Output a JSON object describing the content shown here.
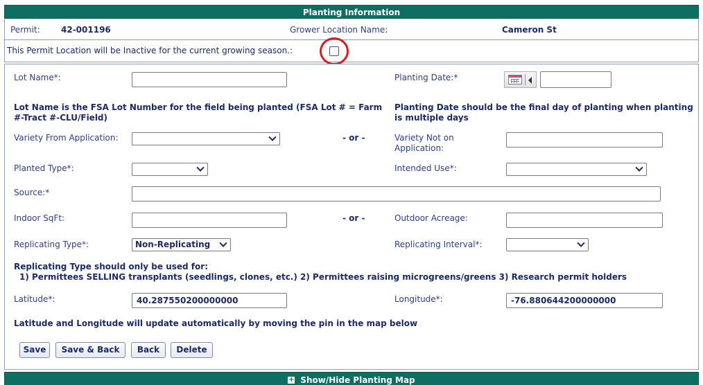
{
  "header": {
    "title": "Planting Information"
  },
  "permit": {
    "permit_label": "Permit:",
    "permit_value": "42-001196",
    "grower_location_label": "Grower Location Name:",
    "grower_location_value": "Cameron St"
  },
  "inactive": {
    "label": "This Permit Location will be Inactive for the current growing season.:",
    "checked": false
  },
  "form": {
    "lot_name_label": "Lot Name*:",
    "lot_name_value": "",
    "planting_date_label": "Planting Date:*",
    "planting_date_value": "",
    "lot_name_note": "Lot Name is the FSA Lot Number for the field being planted (FSA Lot # = Farm #-Tract #-CLU/Field)",
    "planting_date_note": "Planting Date should be the final day of planting when planting is multiple days",
    "variety_from_app_label": "Variety From Application:",
    "variety_from_app_value": "",
    "or_label": "- or -",
    "variety_not_on_app_label": "Variety Not on Application:",
    "variety_not_on_app_value": "",
    "planted_type_label": "Planted Type*:",
    "planted_type_value": "",
    "intended_use_label": "Intended Use*:",
    "intended_use_value": "",
    "source_label": "Source:*",
    "source_value": "",
    "indoor_sqft_label": "Indoor SqFt:",
    "indoor_sqft_value": "",
    "outdoor_acreage_label": "Outdoor Acreage:",
    "outdoor_acreage_value": "",
    "replicating_type_label": "Replicating Type*:",
    "replicating_type_value": "Non-Replicating",
    "replicating_interval_label": "Replicating Interval*:",
    "replicating_interval_value": "",
    "replicating_note_line1": "Replicating Type should only be used for:",
    "replicating_note_line2": "1) Permittees SELLING transplants (seedlings, clones, etc.) 2) Permittees raising microgreens/greens 3) Research permit holders",
    "latitude_label": "Latitude*:",
    "latitude_value": "40.287550200000000",
    "longitude_label": "Longitude*:",
    "longitude_value": "-76.880644200000000",
    "latlong_note": "Latitude and Longitude will update automatically by moving the pin in the map below"
  },
  "buttons": {
    "save": "Save",
    "save_back": "Save & Back",
    "back": "Back",
    "delete": "Delete"
  },
  "footer": {
    "toggle_map_label": "Show/Hide Planting Map",
    "icon": "plus-icon"
  },
  "colors": {
    "header_bg": "#0f6e62",
    "label_text": "#2d3e8c",
    "value_text": "#1a2a6c",
    "highlight": "#e0191b"
  }
}
